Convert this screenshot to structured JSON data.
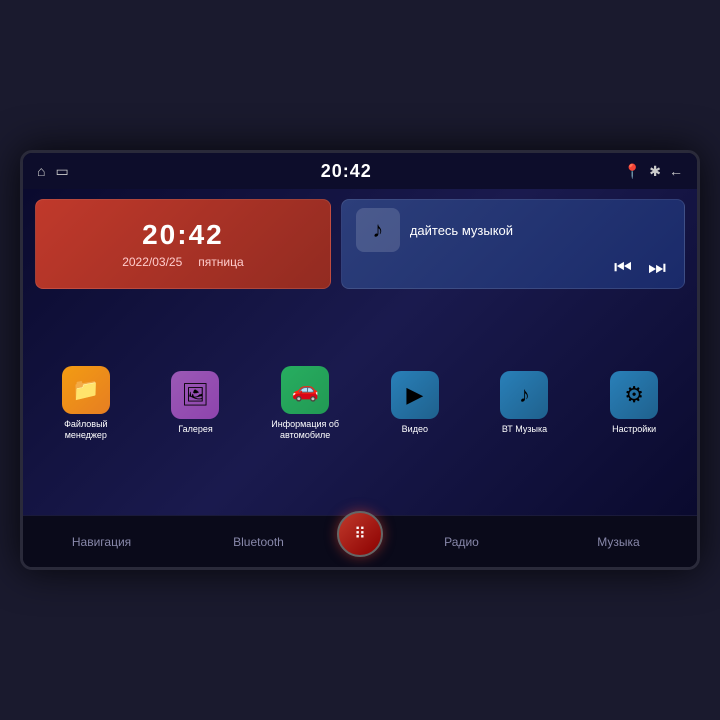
{
  "statusBar": {
    "time": "20:42",
    "homeIcon": "⌂",
    "screenIcon": "▭",
    "locationIcon": "📍",
    "bluetoothIcon": "✱",
    "backIcon": "←"
  },
  "clockWidget": {
    "time": "20:42",
    "date": "2022/03/25",
    "weekday": "пятница"
  },
  "musicWidget": {
    "icon": "♪",
    "title": "дайтесь музыкой",
    "prevIcon": "⏮",
    "nextIcon": "⏭"
  },
  "apps": [
    {
      "id": "files",
      "icon": "📁",
      "label": "Файловый менеджер",
      "iconClass": "app-icon-files"
    },
    {
      "id": "gallery",
      "icon": "🖼",
      "label": "Галерея",
      "iconClass": "app-icon-gallery"
    },
    {
      "id": "car",
      "icon": "🚗",
      "label": "Информация об автомобиле",
      "iconClass": "app-icon-car"
    },
    {
      "id": "video",
      "icon": "▶",
      "label": "Видео",
      "iconClass": "app-icon-video"
    },
    {
      "id": "bt-music",
      "icon": "♪",
      "label": "ВТ Музыка",
      "iconClass": "app-icon-bt"
    },
    {
      "id": "settings",
      "icon": "⚙",
      "label": "Настройки",
      "iconClass": "app-icon-settings"
    }
  ],
  "bottomNav": [
    {
      "id": "navigation",
      "label": "Навигация",
      "active": false
    },
    {
      "id": "bluetooth",
      "label": "Bluetooth",
      "active": false
    },
    {
      "id": "center",
      "label": "···",
      "active": false,
      "isCenter": true
    },
    {
      "id": "radio",
      "label": "Радио",
      "active": false
    },
    {
      "id": "music",
      "label": "Музыка",
      "active": false
    }
  ]
}
